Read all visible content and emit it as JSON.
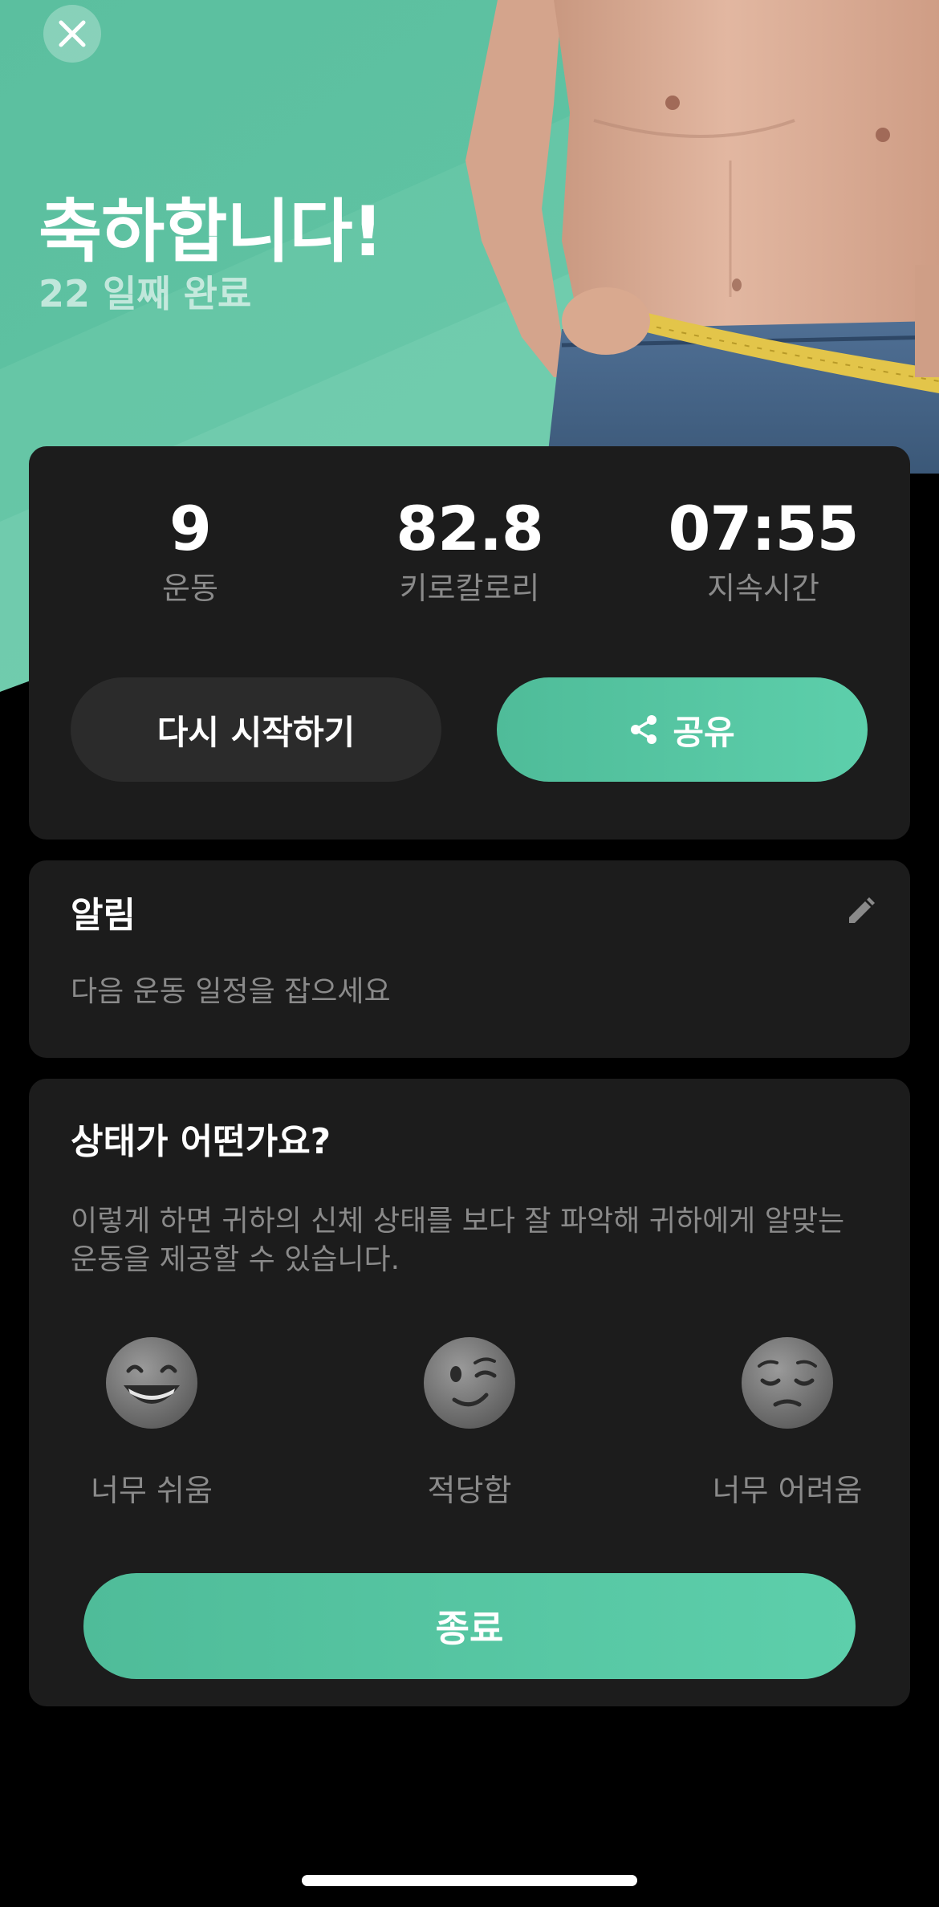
{
  "hero": {
    "title": "축하합니다!",
    "subtitle": "22 일째 완료",
    "close_icon": "close-icon",
    "accent_color": "#5cc4a2"
  },
  "stats": [
    {
      "value": "9",
      "label": "운동"
    },
    {
      "value": "82.8",
      "label": "키로칼로리"
    },
    {
      "value": "07:55",
      "label": "지속시간"
    }
  ],
  "actions": {
    "restart_label": "다시 시작하기",
    "share_label": "공유",
    "share_icon": "share-icon"
  },
  "reminder": {
    "title": "알림",
    "text": "다음 운동 일정을 잡으세요",
    "edit_icon": "pencil-icon"
  },
  "feeling": {
    "title": "상태가 어떤가요?",
    "text_line1": "이렇게 하면 귀하의 신체 상태를 보다 잘 파악해 귀하에게 알맞는",
    "text_line2": "운동을 제공할 수 있습니다.",
    "options": [
      {
        "label": "너무 쉬움",
        "icon": "grinning-face-icon"
      },
      {
        "label": "적당함",
        "icon": "winking-face-icon"
      },
      {
        "label": "너무 어려움",
        "icon": "pensive-face-icon"
      }
    ],
    "finish_label": "종료"
  }
}
